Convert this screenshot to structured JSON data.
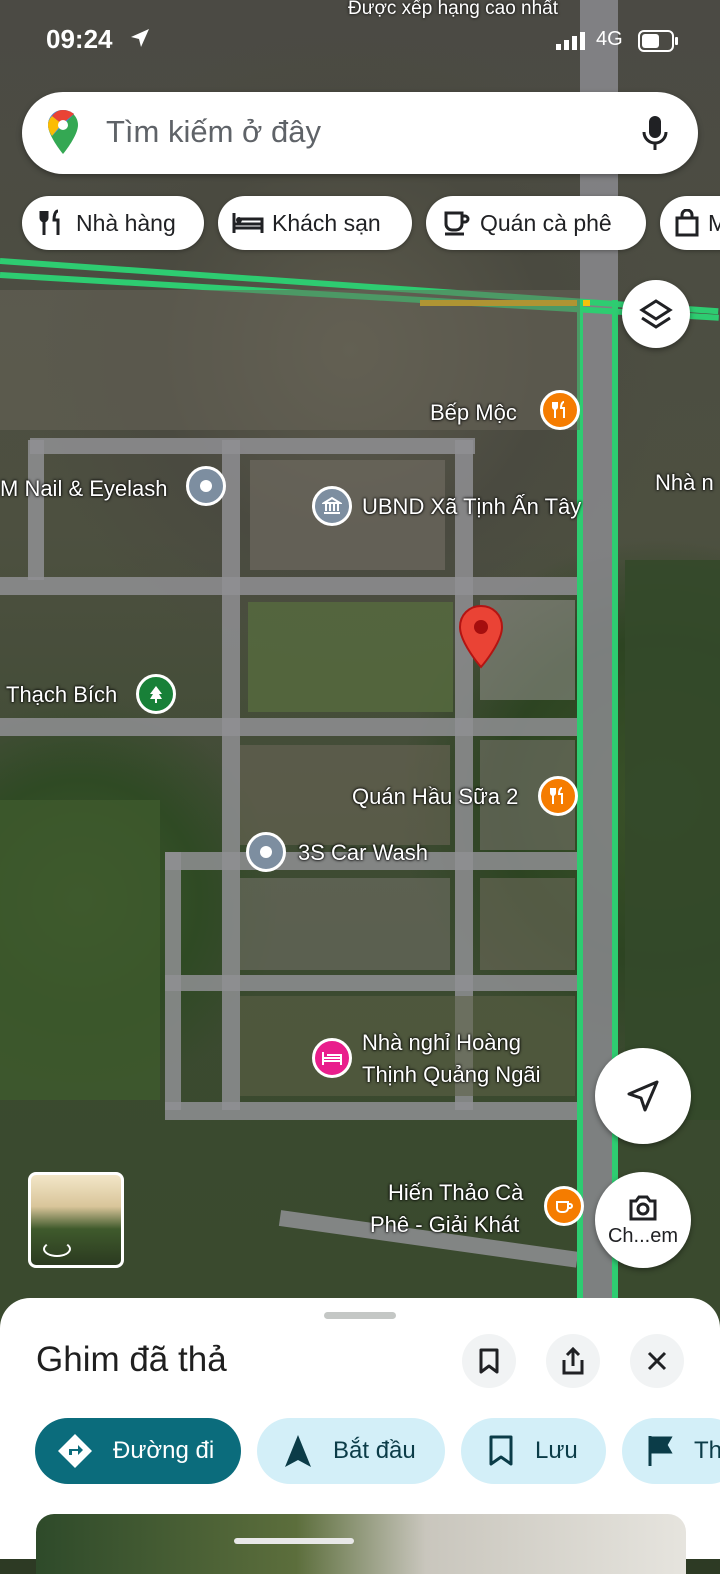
{
  "status": {
    "time": "09:24",
    "network": "4G"
  },
  "top_banner": "Được xếp hạng cao nhất",
  "search": {
    "placeholder": "Tìm kiếm ở đây"
  },
  "chips": [
    {
      "label": "Nhà hàng",
      "icon": "fork-knife-icon"
    },
    {
      "label": "Khách sạn",
      "icon": "bed-icon"
    },
    {
      "label": "Quán cà phê",
      "icon": "coffee-cup-icon"
    },
    {
      "label": "Mua sắm",
      "icon": "shopping-bag-icon"
    }
  ],
  "places": [
    {
      "name": "Bếp Mộc",
      "icon": "restaurant-icon",
      "color": "#f57c00"
    },
    {
      "name": "M Nail & Eyelash",
      "icon": "generic-place-icon",
      "color": "#7d8ea0"
    },
    {
      "name": "UBND Xã Tịnh Ấn Tây",
      "icon": "government-icon",
      "color": "#7d8ea0"
    },
    {
      "name": "Nhà n",
      "icon": "",
      "color": ""
    },
    {
      "name": "Thạch Bích",
      "icon": "tree-icon",
      "color": "#188038"
    },
    {
      "name": "Quán Hầu Sữa 2",
      "icon": "restaurant-icon",
      "color": "#f57c00"
    },
    {
      "name": "3S Car Wash",
      "icon": "generic-place-icon",
      "color": "#7d8ea0"
    },
    {
      "name": "Nhà nghỉ Hoàng",
      "name2": "Thịnh Quảng Ngãi",
      "icon": "hotel-icon",
      "color": "#e91e8c"
    },
    {
      "name": "Hiến Thảo Cà",
      "name2": "Phê - Giải Khát",
      "icon": "cafe-icon",
      "color": "#f57c00"
    }
  ],
  "fabs": {
    "lens_label": "Ch...em"
  },
  "sheet": {
    "title": "Ghim đã thả",
    "actions": [
      {
        "label": "Đường đi",
        "icon": "directions-icon"
      },
      {
        "label": "Bắt đầu",
        "icon": "navigate-arrow-icon"
      },
      {
        "label": "Lưu",
        "icon": "bookmark-icon"
      },
      {
        "label": "Th",
        "icon": "flag-icon"
      }
    ]
  },
  "colors": {
    "primary": "#0b6c7c",
    "tonal": "#d3eff8",
    "pin": "#ea4335",
    "traffic_green": "#2ecc71",
    "traffic_yellow": "#f4c20d"
  }
}
